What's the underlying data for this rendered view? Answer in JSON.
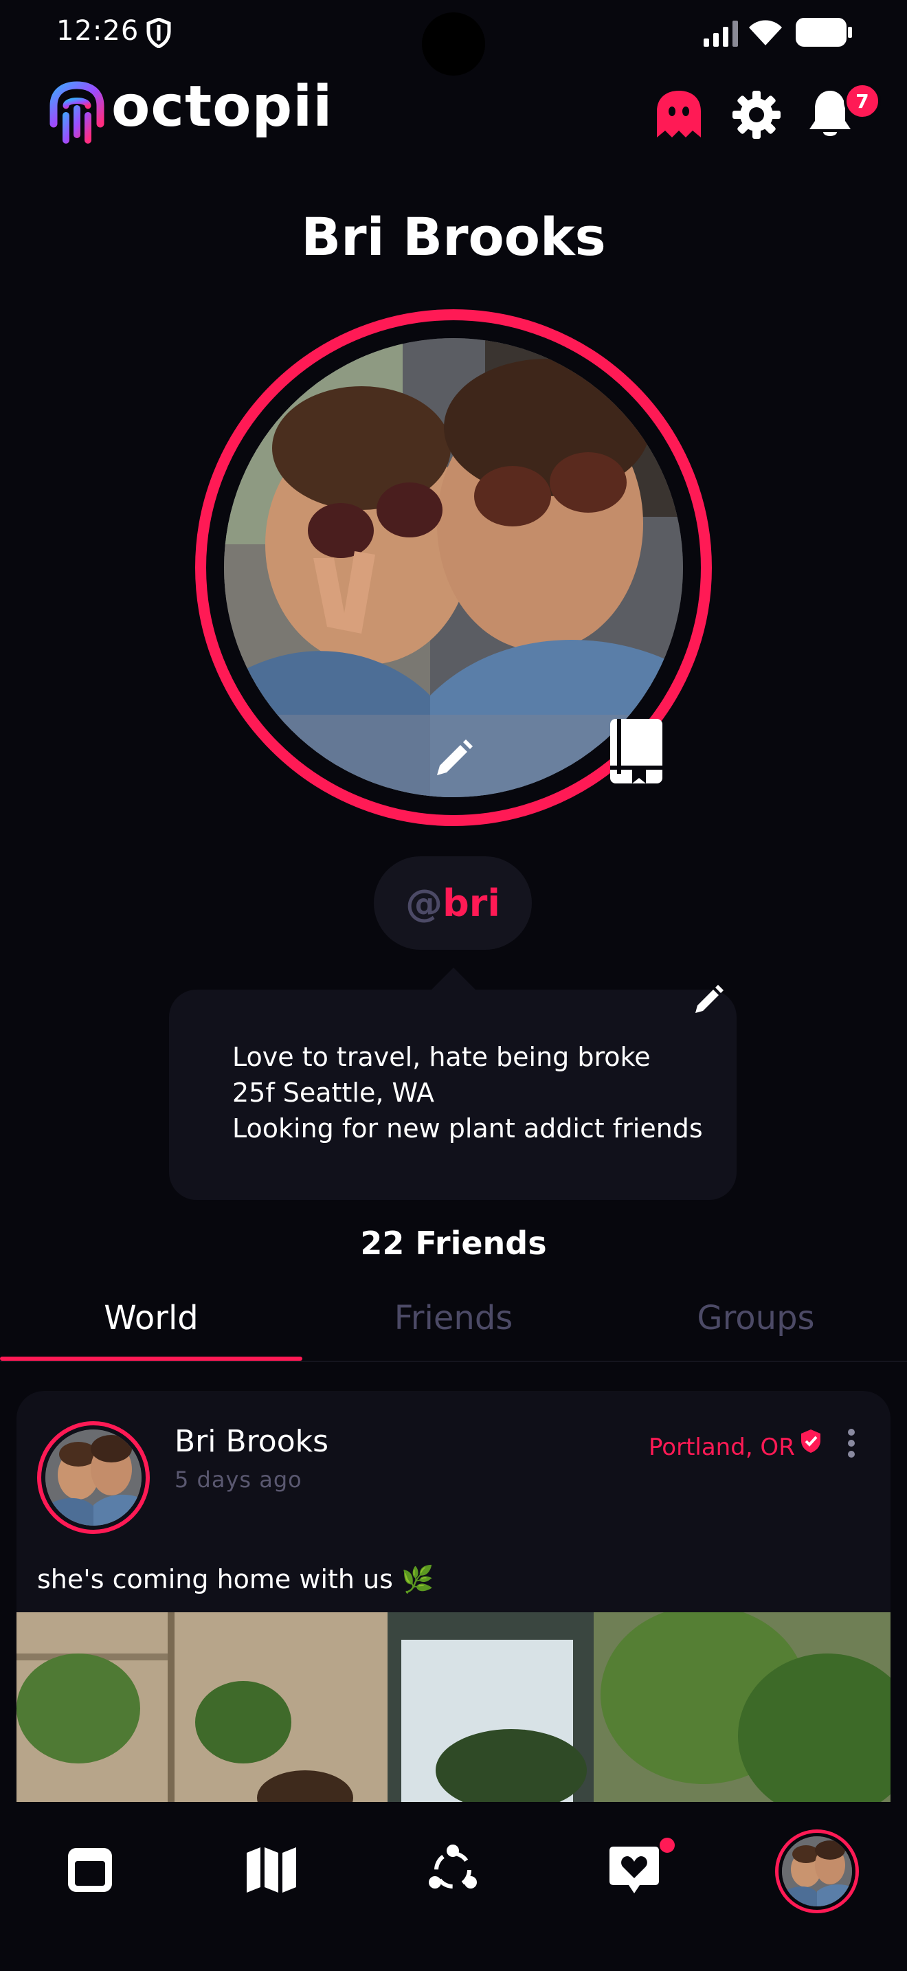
{
  "status_bar": {
    "time": "12:26"
  },
  "header": {
    "app_name": "octopii",
    "notification_count": "7"
  },
  "profile": {
    "name": "Bri Brooks",
    "handle_at": "@",
    "handle_name": "bri",
    "bio_lines": [
      "Love to travel, hate being broke",
      "25f Seattle, WA",
      "Looking for new plant addict friends"
    ],
    "friends_count": "22 Friends"
  },
  "tabs": [
    {
      "label": "World",
      "active": true
    },
    {
      "label": "Friends",
      "active": false
    },
    {
      "label": "Groups",
      "active": false
    }
  ],
  "post": {
    "author": "Bri Brooks",
    "time": "5 days ago",
    "location": "Portland, OR",
    "caption": "she's coming home with us 🌿"
  },
  "colors": {
    "accent": "#ff1a55",
    "background": "#07070d",
    "card": "#11111b",
    "muted": "#4c4a66"
  },
  "icons": {
    "status": [
      "shield-icon",
      "signal-icon",
      "wifi-icon",
      "battery-icon"
    ],
    "header": [
      "ghost-icon",
      "gear-icon",
      "bell-icon"
    ],
    "nav": [
      "browser-window-icon",
      "map-icon",
      "network-icon",
      "heart-chat-icon",
      "profile-avatar"
    ]
  }
}
